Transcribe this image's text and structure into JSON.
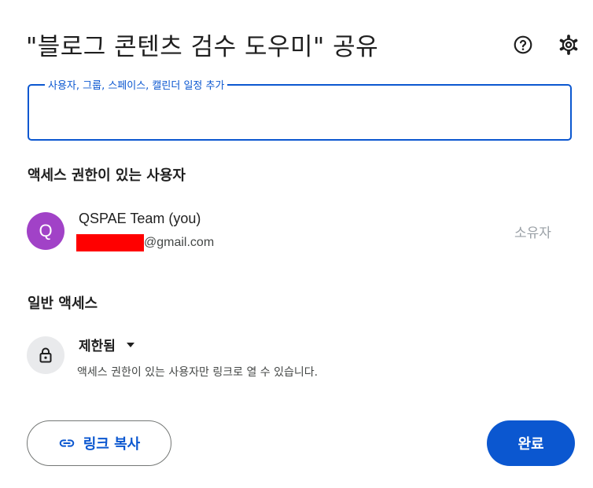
{
  "dialog": {
    "title": "\"블로그 콘텐츠 검수 도우미\" 공유"
  },
  "header_icons": {
    "help": "help-circle-icon",
    "settings": "gear-icon"
  },
  "share_input": {
    "label": "사용자, 그룹, 스페이스, 캘린더 일정 추가",
    "value": ""
  },
  "access_section": {
    "heading": "액세스 권한이 있는 사용자",
    "users": [
      {
        "avatar_letter": "Q",
        "avatar_color": "#a142c7",
        "name": "QSPAE Team (you)",
        "email_visible": "@gmail.com",
        "role": "소유자"
      }
    ]
  },
  "general_access": {
    "heading": "일반 액세스",
    "icon": "lock-icon",
    "setting": "제한됨",
    "description": "액세스 권한이 있는 사용자만 링크로 열 수 있습니다."
  },
  "footer": {
    "copy_link_label": "링크 복사",
    "done_label": "완료"
  },
  "colors": {
    "accent": "#0b57d0",
    "redaction": "#ff0000"
  }
}
